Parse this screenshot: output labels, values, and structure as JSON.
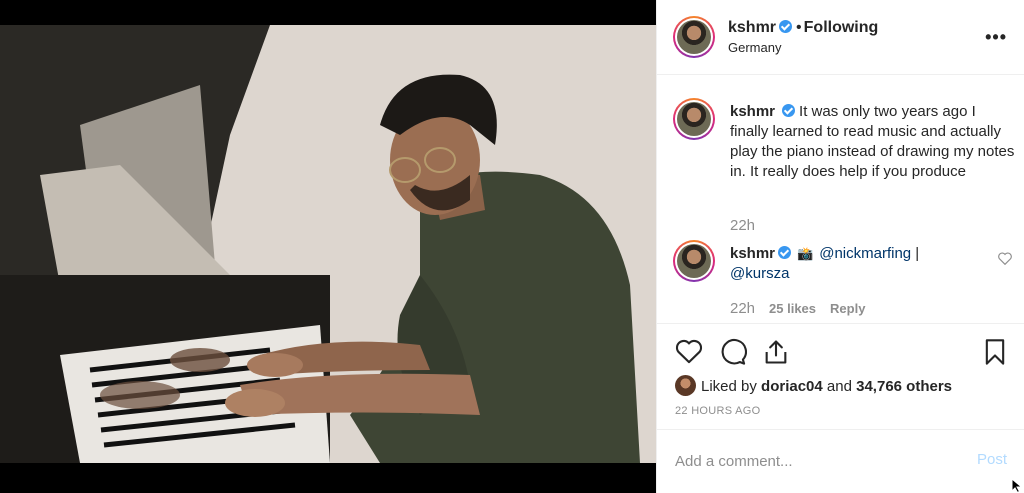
{
  "post": {
    "username": "kshmr",
    "follow_status": "Following",
    "location": "Germany",
    "more_icon": "more-horizontal-icon"
  },
  "comments": [
    {
      "username": "kshmr",
      "text": "It was only two years ago I finally learned to read music and actually play the piano instead of drawing my notes in. It really does help if you produce",
      "time": "22h"
    },
    {
      "username": "kshmr",
      "emoji": "📸",
      "mention1": "@nickmarfing",
      "separator": " |",
      "mention2": "@kursza",
      "time": "22h",
      "likes": "25 likes",
      "reply_label": "Reply"
    }
  ],
  "actions": {
    "liked_prefix": "Liked by",
    "liked_user": "doriac04",
    "liked_and": "and",
    "liked_others": "34,766 others",
    "timestamp": "22 HOURS AGO"
  },
  "comment_box": {
    "placeholder": "Add a comment...",
    "post_label": "Post"
  },
  "colors": {
    "verified": "#3897f0",
    "mention": "#003569",
    "post_disabled": "#b3dbff",
    "muted": "#8e8e8e"
  }
}
